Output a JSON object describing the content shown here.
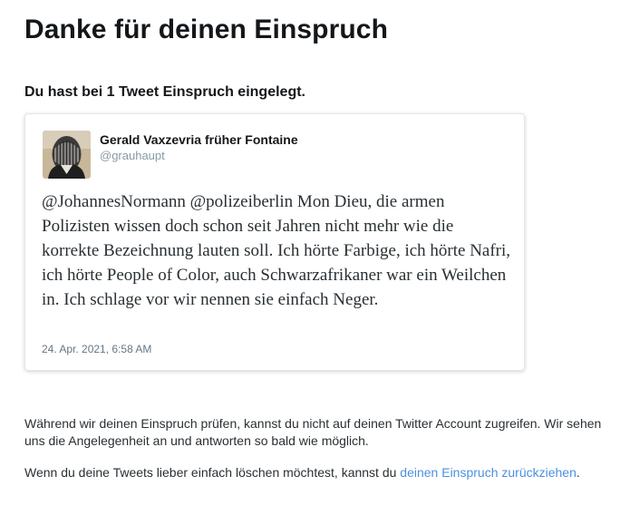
{
  "page": {
    "title": "Danke für deinen Einspruch",
    "subtitle": "Du hast bei 1 Tweet Einspruch eingelegt."
  },
  "tweet": {
    "author_name": "Gerald Vaxzevria früher Fontaine",
    "author_handle": "@grauhaupt",
    "avatar_icon": "masked-face-avatar",
    "text": "@JohannesNormann @polizeiberlin Mon Dieu, die armen Polizisten wissen doch schon seit Jahren nicht mehr wie die korrekte Bezeichnung lauten soll. Ich hörte Farbige, ich hörte Nafri, ich hörte People of Color, auch Schwarzafrikaner war ein Weilchen in. Ich schlage vor wir nennen sie einfach Neger.",
    "date": "24. Apr. 2021, 6:58 AM"
  },
  "info": {
    "review_text": "Während wir deinen Einspruch prüfen, kannst du nicht auf deinen Twitter Account zugreifen. Wir sehen uns die Angelegenheit an und antworten so bald wie möglich.",
    "delete_text": "Wenn du deine Tweets lieber einfach löschen möchtest, kannst du ",
    "withdraw_link": "deinen Einspruch zurückziehen",
    "delete_suffix": "."
  },
  "colors": {
    "link": "#4a90e2",
    "handle": "#8899a6",
    "text": "#14171a"
  }
}
